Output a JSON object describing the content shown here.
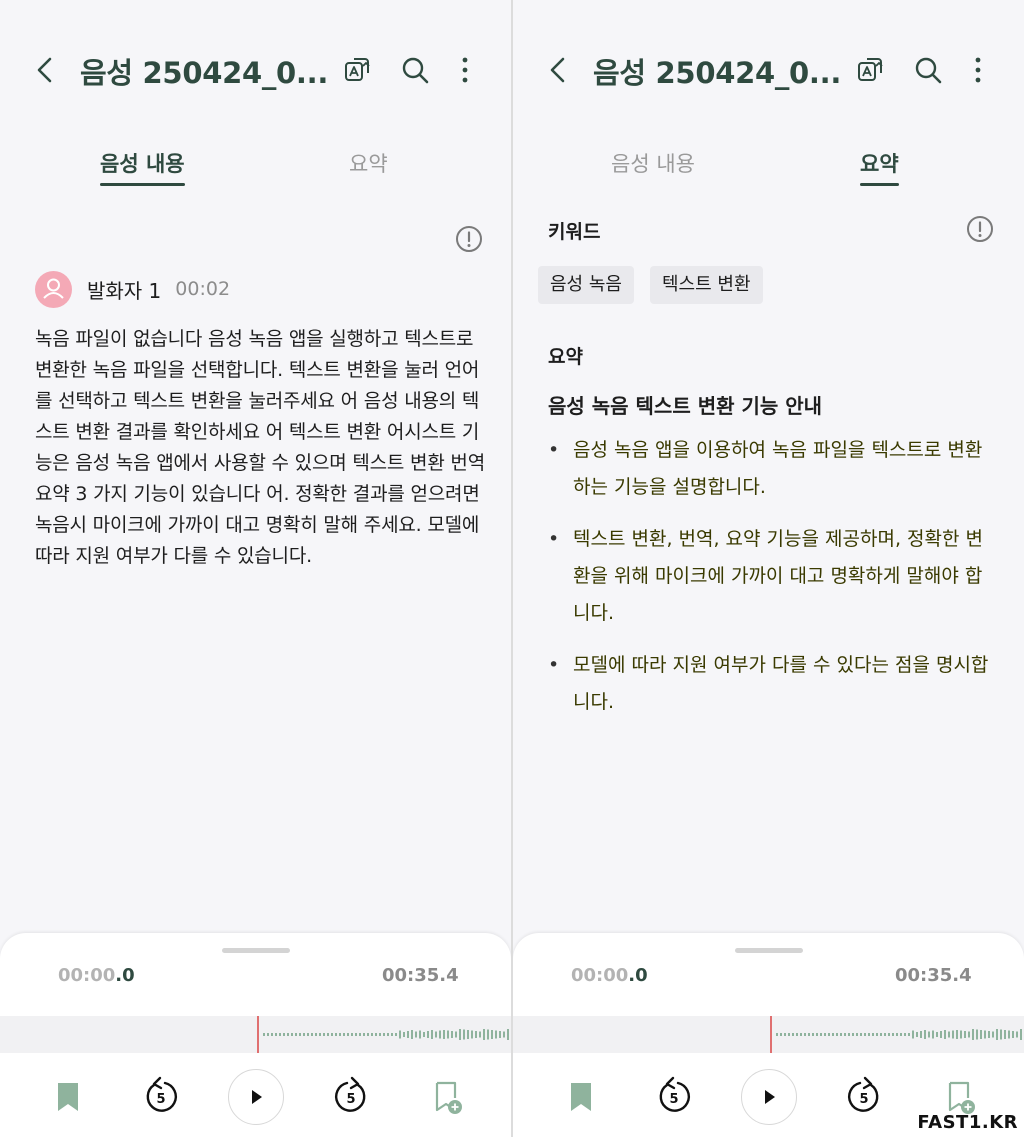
{
  "left": {
    "header": {
      "title": "음성 250424_0..."
    },
    "tabs": [
      {
        "label": "음성 내용",
        "active": true
      },
      {
        "label": "요약",
        "active": false
      }
    ],
    "transcript": {
      "speaker": "발화자 1",
      "time": "00:02",
      "text": "녹음 파일이 없습니다 음성 녹음 앱을 실행하고 텍스트로 변환한 녹음 파일을 선택합니다. 텍스트 변환을 눌러 언어를 선택하고 텍스트 변환을 눌러주세요 어 음성 내용의 텍스트 변환 결과를 확인하세요 어 텍스트 변환 어시스트 기능은 음성 녹음 앱에서 사용할 수 있으며 텍스트 변환 번역 요약 3 가지 기능이 있습니다 어. 정확한 결과를 얻으려면 녹음시 마이크에 가까이 대고 명확히 말해 주세요. 모델에 따라 지원 여부가 다를 수 있습니다."
    },
    "player": {
      "current_main": "00:00",
      "current_dec": ".0",
      "end": "00:35.4",
      "progress": 0.0
    }
  },
  "right": {
    "header": {
      "title": "음성 250424_0..."
    },
    "tabs": [
      {
        "label": "음성 내용",
        "active": false
      },
      {
        "label": "요약",
        "active": true
      }
    ],
    "keywords_label": "키워드",
    "keywords": [
      "음성 녹음",
      "텍스트 변환"
    ],
    "summary_label": "요약",
    "summary_title": "음성 녹음 텍스트 변환 기능 안내",
    "bullets": [
      "음성 녹음 앱을 이용하여 녹음 파일을 텍스트로 변환하는 기능을 설명합니다.",
      "텍스트 변환, 번역, 요약 기능을 제공하며, 정확한 변환을 위해 마이크에 가까이 대고 명확하게 말해야 합니다.",
      "모델에 따라 지원 여부가 다를 수 있다는 점을 명시합니다."
    ],
    "player": {
      "current_main": "00:00",
      "current_dec": ".0",
      "end": "00:35.4",
      "progress": 0.0
    }
  },
  "skip_amount": "5",
  "icons": {
    "back": "chevron-left-icon",
    "translate": "translate-icon",
    "search": "search-icon",
    "more": "more-vertical-icon",
    "info": "info-icon",
    "bookmark": "bookmark-icon",
    "rewind": "rewind-5-icon",
    "play": "play-icon",
    "forward": "forward-5-icon",
    "add_bookmark": "bookmark-add-icon"
  },
  "colors": {
    "accent": "#2f4a40",
    "playhead": "#e07070",
    "wave": "#8fb39d",
    "avatar": "#f4a9b6"
  },
  "watermark": "FAST1.KR"
}
